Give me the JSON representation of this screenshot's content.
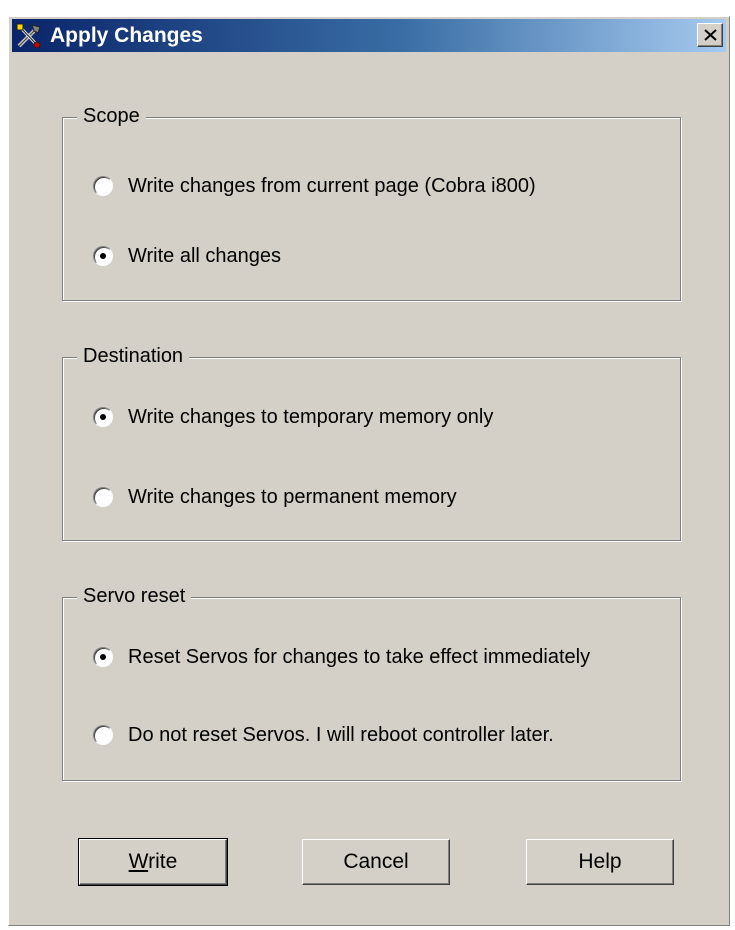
{
  "window": {
    "title": "Apply Changes",
    "icon": "tools-icon",
    "close_label": "close"
  },
  "groups": {
    "scope": {
      "legend": "Scope",
      "options": [
        {
          "label": "Write changes from current page (Cobra i800)",
          "selected": false
        },
        {
          "label": "Write all changes",
          "selected": true
        }
      ]
    },
    "destination": {
      "legend": "Destination",
      "options": [
        {
          "label": "Write changes to temporary memory only",
          "selected": true
        },
        {
          "label": "Write changes to permanent memory",
          "selected": false
        }
      ]
    },
    "servo_reset": {
      "legend": "Servo reset",
      "options": [
        {
          "label": "Reset Servos for changes to take effect immediately",
          "selected": true
        },
        {
          "label": "Do not reset Servos. I will reboot controller later.",
          "selected": false
        }
      ]
    }
  },
  "buttons": {
    "write_mnemonic": "W",
    "write_rest": "rite",
    "cancel": "Cancel",
    "help": "Help"
  },
  "colors": {
    "dialog_face": "#d4d0c8",
    "title_gradient_start": "#0a246a",
    "title_gradient_end": "#a6caf0"
  }
}
